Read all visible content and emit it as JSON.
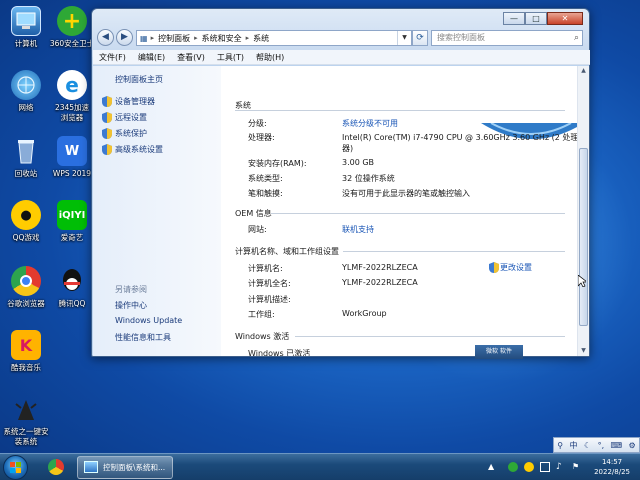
{
  "desktop_icons": [
    {
      "id": "computer",
      "label": "计算机",
      "icon": "computer-icon"
    },
    {
      "id": "360",
      "label": "360安全卫士",
      "icon": "360-icon"
    },
    {
      "id": "network",
      "label": "网络",
      "icon": "network-icon"
    },
    {
      "id": "2345",
      "label": "2345加速浏览器",
      "icon": "2345-browser-icon"
    },
    {
      "id": "recycle",
      "label": "回收站",
      "icon": "recycle-bin-icon"
    },
    {
      "id": "wps",
      "label": "WPS 2019",
      "icon": "wps-icon"
    },
    {
      "id": "qqgame",
      "label": "QQ游戏",
      "icon": "qq-game-icon"
    },
    {
      "id": "iqiyi",
      "label": "爱奇艺",
      "icon": "iqiyi-icon"
    },
    {
      "id": "chrome",
      "label": "谷歌浏览器",
      "icon": "chrome-icon"
    },
    {
      "id": "qq",
      "label": "腾讯QQ",
      "icon": "qq-icon"
    },
    {
      "id": "kugou",
      "label": "酷我音乐",
      "icon": "kuwo-icon"
    },
    {
      "id": "sysinstall",
      "label": "系统之一键安装系统",
      "icon": "install-system-icon"
    }
  ],
  "window": {
    "controls": {
      "minimize": "—",
      "maximize": "□",
      "close": "✕"
    },
    "breadcrumb": [
      "控制面板",
      "系统和安全",
      "系统"
    ],
    "search_placeholder": "搜索控制面板",
    "menu": [
      "文件(F)",
      "编辑(E)",
      "查看(V)",
      "工具(T)",
      "帮助(H)"
    ]
  },
  "sidebar": {
    "home": "控制面板主页",
    "links": [
      "设备管理器",
      "远程设置",
      "系统保护",
      "高级系统设置"
    ],
    "see_also_heading": "另请参阅",
    "see_also": [
      "操作中心",
      "Windows Update",
      "性能信息和工具"
    ]
  },
  "system": {
    "heading": "系统",
    "rows": [
      {
        "label": "分级:",
        "value": "系统分级不可用",
        "link": true
      },
      {
        "label": "处理器:",
        "value": "Intel(R) Core(TM) i7-4790 CPU @ 3.60GHz   3.60 GHz  (2 处理",
        "value2": "器)",
        "link": false
      },
      {
        "label": "安装内存(RAM):",
        "value": "3.00 GB",
        "link": false
      },
      {
        "label": "系统类型:",
        "value": "32 位操作系统",
        "link": false
      },
      {
        "label": "笔和触摸:",
        "value": "没有可用于此显示器的笔或触控输入",
        "link": false
      }
    ]
  },
  "oem": {
    "heading": "OEM 信息",
    "rows": [
      {
        "label": "网站:",
        "value": "联机支持",
        "link": true
      }
    ]
  },
  "computer_name": {
    "heading": "计算机名称、域和工作组设置",
    "rows": [
      {
        "label": "计算机名:",
        "value": "YLMF-2022RLZECA"
      },
      {
        "label": "计算机全名:",
        "value": "YLMF-2022RLZECA"
      },
      {
        "label": "计算机描述:",
        "value": ""
      },
      {
        "label": "工作组:",
        "value": "WorkGroup"
      }
    ],
    "change_settings": "更改设置"
  },
  "activation": {
    "heading": "Windows 激活",
    "status": "Windows 已激活",
    "badge": "微软 软件"
  },
  "taskbar": {
    "active_window": "控制面板\\系统和...",
    "time": "14:57",
    "date": "2022/8/25"
  },
  "langbar": {
    "lang": "中"
  }
}
